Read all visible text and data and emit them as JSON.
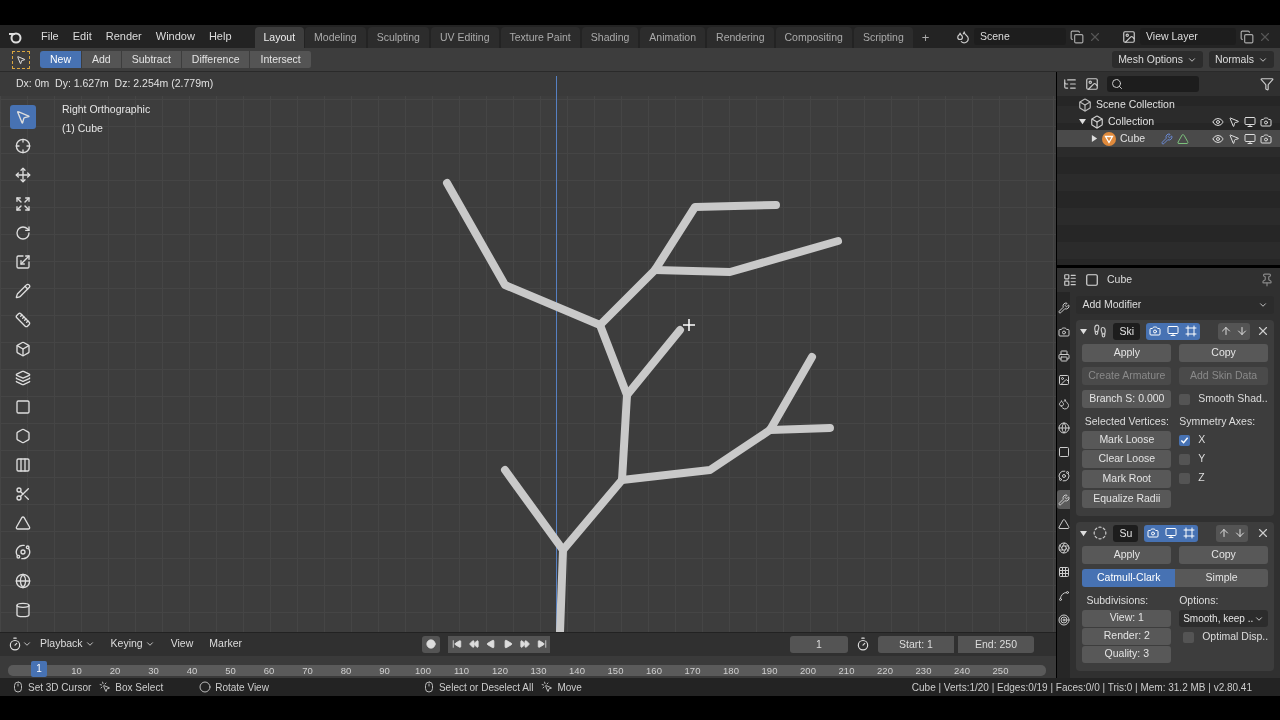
{
  "menus": [
    "File",
    "Edit",
    "Render",
    "Window",
    "Help"
  ],
  "workspaces": [
    {
      "label": "Layout",
      "selected": true
    },
    {
      "label": "Modeling",
      "selected": false
    },
    {
      "label": "Sculpting",
      "selected": false
    },
    {
      "label": "UV Editing",
      "selected": false
    },
    {
      "label": "Texture Paint",
      "selected": false
    },
    {
      "label": "Shading",
      "selected": false
    },
    {
      "label": "Animation",
      "selected": false
    },
    {
      "label": "Rendering",
      "selected": false
    },
    {
      "label": "Compositing",
      "selected": false
    },
    {
      "label": "Scripting",
      "selected": false
    }
  ],
  "add_workspace": "+",
  "scene": "Scene",
  "view_layer": "View Layer",
  "boolean_modes": [
    {
      "label": "New",
      "selected": true
    },
    {
      "label": "Add",
      "selected": false
    },
    {
      "label": "Subtract",
      "selected": false
    },
    {
      "label": "Difference",
      "selected": false
    },
    {
      "label": "Intersect",
      "selected": false
    }
  ],
  "header_menus": [
    "Mesh Options",
    "Normals"
  ],
  "viewport": {
    "status": "Dx: 0m  Dy: 1.627m  Dz: 2.254m (2.779m)",
    "view": "Right Orthographic",
    "object": "(1) Cube"
  },
  "tools": [
    {
      "kind": "select",
      "selected": true
    },
    {
      "kind": "cursor",
      "selected": false
    },
    {
      "kind": "move",
      "selected": false
    },
    {
      "kind": "translate",
      "selected": false
    },
    {
      "kind": "rotate",
      "selected": false
    },
    {
      "kind": "scale",
      "selected": false
    },
    {
      "kind": "annotate",
      "selected": false
    },
    {
      "kind": "measure",
      "selected": false
    },
    {
      "kind": "add",
      "selected": false
    },
    {
      "kind": "extrude",
      "selected": false
    },
    {
      "kind": "inset",
      "selected": false
    },
    {
      "kind": "bevel",
      "selected": false
    },
    {
      "kind": "loopcut",
      "selected": false
    },
    {
      "kind": "knife",
      "selected": false
    },
    {
      "kind": "polybuild",
      "selected": false
    },
    {
      "kind": "spin",
      "selected": false
    },
    {
      "kind": "smooth",
      "selected": false
    },
    {
      "kind": "shrink",
      "selected": false
    }
  ],
  "outliner": {
    "items": [
      {
        "label": "Scene Collection",
        "selected": false,
        "children": [
          {
            "label": "Collection",
            "selected": false,
            "expanded": true,
            "children": [
              {
                "label": "Cube",
                "selected": true,
                "expanded": false
              }
            ]
          }
        ]
      }
    ]
  },
  "properties": {
    "object": "Cube",
    "add_modifier": "Add Modifier",
    "tabs": [
      {
        "kind": "tool",
        "selected": false
      },
      {
        "kind": "render",
        "selected": false
      },
      {
        "kind": "output",
        "selected": false
      },
      {
        "kind": "view-layer",
        "selected": false
      },
      {
        "kind": "scene",
        "selected": false
      },
      {
        "kind": "world",
        "selected": false
      },
      {
        "kind": "object",
        "selected": false
      },
      {
        "kind": "constraint",
        "selected": false
      },
      {
        "kind": "modifier",
        "selected": true
      },
      {
        "kind": "data",
        "selected": false
      },
      {
        "kind": "material",
        "selected": false
      },
      {
        "kind": "texture",
        "selected": false
      },
      {
        "kind": "particles",
        "selected": false
      },
      {
        "kind": "physics",
        "selected": false
      }
    ],
    "skin": {
      "name": "Ski",
      "expanded": true,
      "toggles": [
        {
          "kind": "render",
          "on": true
        },
        {
          "kind": "viewport",
          "on": true
        },
        {
          "kind": "editmode",
          "on": true
        }
      ],
      "apply": "Apply",
      "copy": "Copy",
      "actions": [
        {
          "label": "Create Armature",
          "disabled": true
        },
        {
          "label": "Add Skin Data",
          "disabled": true
        }
      ],
      "branch": {
        "label": "Branch S:",
        "value": "0.000"
      },
      "smooth": {
        "label": "Smooth Shad..",
        "checked": false
      },
      "selected_heading": "Selected Vertices:",
      "vertex_buttons": [
        "Mark Loose",
        "Clear Loose",
        "Mark Root",
        "Equalize Radii"
      ],
      "symmetry_heading": "Symmetry Axes:",
      "axes": [
        {
          "label": "X",
          "checked": true
        },
        {
          "label": "Y",
          "checked": false
        },
        {
          "label": "Z",
          "checked": false
        }
      ]
    },
    "subsurf": {
      "name": "Su",
      "expanded": true,
      "toggles": [
        {
          "kind": "render",
          "on": true
        },
        {
          "kind": "viewport",
          "on": true
        },
        {
          "kind": "editmode",
          "on": true
        }
      ],
      "apply": "Apply",
      "copy": "Copy",
      "algorithms": [
        {
          "label": "Catmull-Clark",
          "selected": true
        },
        {
          "label": "Simple",
          "selected": false
        }
      ],
      "subdivisions_heading": "Subdivisions:",
      "levels": [
        {
          "label": "View:",
          "value": "1"
        },
        {
          "label": "Render:",
          "value": "2"
        },
        {
          "label": "Quality:",
          "value": "3"
        }
      ],
      "options_heading": "Options:",
      "uv_smooth": "Smooth, keep ..",
      "optimal": {
        "label": "Optimal Disp..",
        "checked": false
      }
    }
  },
  "timeline": {
    "menus": [
      "Playback",
      "Keying",
      "View",
      "Marker"
    ],
    "current_frame": "1",
    "start": {
      "label": "Start:",
      "value": "1"
    },
    "end": {
      "label": "End:",
      "value": "250"
    },
    "marker": "1",
    "ticks": [
      "10",
      "20",
      "30",
      "40",
      "50",
      "60",
      "70",
      "80",
      "90",
      "100",
      "110",
      "120",
      "130",
      "140",
      "150",
      "160",
      "170",
      "180",
      "190",
      "200",
      "210",
      "220",
      "230",
      "240",
      "250"
    ]
  },
  "status": {
    "hints": [
      {
        "kind": "left",
        "label": "Set 3D Cursor"
      },
      {
        "kind": "drag",
        "label": "Box Select"
      },
      {
        "kind": "middle",
        "label": "Rotate View"
      },
      {
        "kind": "left",
        "label": "Select or Deselect All"
      },
      {
        "kind": "drag",
        "label": "Move"
      }
    ],
    "stats": "Cube | Verts:1/20 | Edges:0/19 | Faces:0/0 | Tris:0 | Mem: 31.2 MB | v2.80.41"
  }
}
